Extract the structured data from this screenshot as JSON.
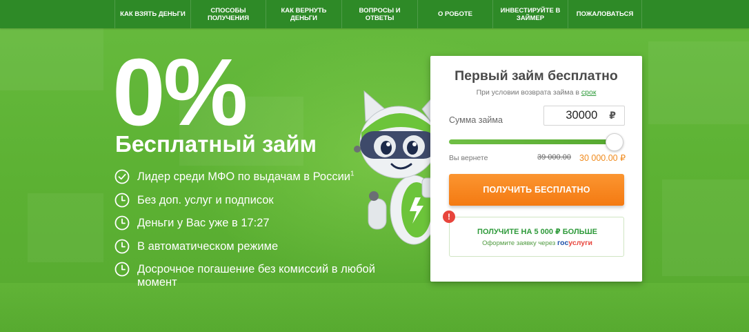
{
  "nav": {
    "items": [
      {
        "label": "КАК ВЗЯТЬ ДЕНЬГИ",
        "width": 110
      },
      {
        "label": "СПОСОБЫ ПОЛУЧЕНИЯ",
        "width": 109
      },
      {
        "label": "КАК ВЕРНУТЬ ДЕНЬГИ",
        "width": 110
      },
      {
        "label": "ВОПРОСЫ И ОТВЕТЫ",
        "width": 110
      },
      {
        "label": "О РОБОТЕ",
        "width": 109
      },
      {
        "label": "ИНВЕСТИРУЙТЕ В ЗАЙМЕР",
        "width": 109
      },
      {
        "label": "ПОЖАЛОВАТЬСЯ",
        "width": 108
      }
    ]
  },
  "hero": {
    "headline": "0%",
    "subtitle": "Бесплатный займ",
    "features": [
      {
        "text": "Лидер среди МФО по выдачам в России",
        "sup": "1",
        "icon": "check-circle-icon"
      },
      {
        "text": "Без доп. услуг и подписок",
        "icon": "clock-icon"
      },
      {
        "text": "Деньги у Вас уже в 17:27",
        "icon": "clock-icon"
      },
      {
        "text": "В автоматическом режиме",
        "icon": "clock-icon"
      },
      {
        "text": "Досрочное погашение без комиссий в любой момент",
        "icon": "clock-icon"
      }
    ]
  },
  "card": {
    "title": "Первый займ бесплатно",
    "note_prefix": "При условии возврата займа в ",
    "note_link": "срок",
    "amount_label": "Сумма займа",
    "amount_value": "30000",
    "currency": "₽",
    "slider_fraction": 0.95,
    "return_label": "Вы вернете",
    "return_old": "39 000.00",
    "return_new": "30 000.00 ₽",
    "cta": "ПОЛУЧИТЬ БЕСПЛАТНО",
    "promo": {
      "alert": "!",
      "title": "ПОЛУЧИТЕ НА 5 000 ₽ БОЛЬШЕ",
      "sub_prefix": "Оформите заявку через ",
      "gos_part1": "гос",
      "gos_part2": "услуги"
    }
  },
  "colors": {
    "nav_bg": "#2e8a27",
    "hero_bg": "#5fb33a",
    "accent_orange": "#f47a12",
    "brand_green": "#2e9a3a"
  }
}
